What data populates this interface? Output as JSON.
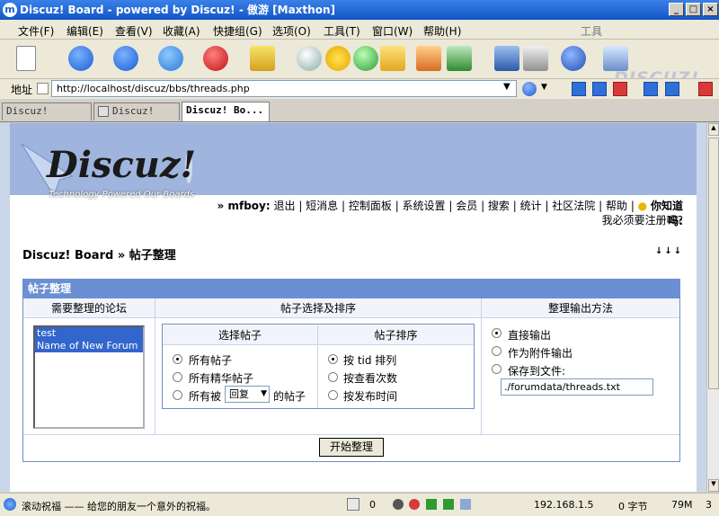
{
  "window": {
    "title": "Discuz! Board - powered by Discuz! - 傲游 [Maxthon]"
  },
  "menu": [
    "文件(F)",
    "编辑(E)",
    "查看(V)",
    "收藏(A)",
    "快捷组(G)",
    "选项(O)",
    "工具(T)",
    "窗口(W)",
    "帮助(H)"
  ],
  "toolbar_right_label": "工具",
  "address": {
    "label": "地址",
    "url": "http://localhost/discuz/bbs/threads.php"
  },
  "tabs": [
    "Discuz! Boar...",
    "Discuz! B...",
    "Discuz! Bo..."
  ],
  "logo": {
    "tagline": "Technology Powered Our Boards",
    "brand": "DISCUZ!"
  },
  "userbar": {
    "user": "» mfboy:",
    "links": [
      "退出",
      "短消息",
      "控制面板",
      "系统设置",
      "会员",
      "搜索",
      "统计",
      "社区法院",
      "帮助"
    ],
    "tip_label": "你知道吗:",
    "tip_text": "我必须要注册吗?"
  },
  "breadcrumb": {
    "root": "Discuz! Board",
    "sep": "»",
    "current": "帖子整理"
  },
  "panel": {
    "title": "帖子整理",
    "col1": "需要整理的论坛",
    "col2": "帖子选择及排序",
    "col3": "整理输出方法",
    "forums": [
      "test",
      "Name of New Forum"
    ],
    "select_header": "选择帖子",
    "sort_header": "帖子排序",
    "select_options": [
      "所有帖子",
      "所有精华帖子",
      "所有被"
    ],
    "select_suffix": "的帖子",
    "reply_select": "回复",
    "sort_options": [
      "按 tid 排列",
      "按查看次数",
      "按发布时间"
    ],
    "output_options": [
      "直接输出",
      "作为附件输出",
      "保存到文件:"
    ],
    "file_path": "./forumdata/threads.txt",
    "submit": "开始整理"
  },
  "status": {
    "text": "滚动祝福 —— 给您的朋友一个意外的祝福。",
    "count": "0",
    "ip": "192.168.1.5",
    "bytes": "0 字节",
    "mem": "79M",
    "num": "3"
  },
  "colors": {
    "title_bar": "#1a5fd0",
    "panel_header": "#6a8fd3",
    "header_band": "#9fb5dd",
    "selection": "#3366cc"
  }
}
